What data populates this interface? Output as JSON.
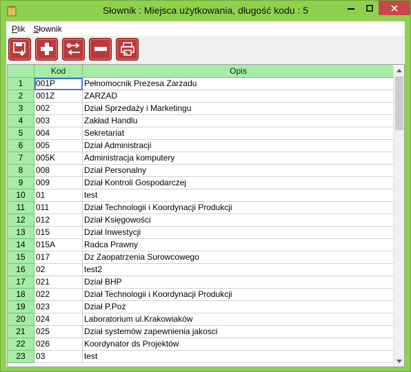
{
  "window": {
    "title": "Słownik : Miejsca użytkowania,  długość kodu : 5"
  },
  "menu": [
    {
      "label": "Plik",
      "accel": "P",
      "rest": "lik"
    },
    {
      "label": "Słownik",
      "accel": "S",
      "rest": "łownik"
    }
  ],
  "toolbar": [
    {
      "name": "save-button",
      "icon": "save-icon"
    },
    {
      "name": "add-button",
      "icon": "plus-icon"
    },
    {
      "name": "swap-button",
      "icon": "key-swap-icon"
    },
    {
      "name": "remove-button",
      "icon": "minus-icon"
    },
    {
      "name": "print-button",
      "icon": "printer-icon"
    }
  ],
  "table": {
    "columns": [
      "Kod",
      "Opis"
    ],
    "rows": [
      {
        "n": "1",
        "kod": "001P",
        "opis": "Pełnomocnik Prezesa Zarzadu"
      },
      {
        "n": "2",
        "kod": "001Z",
        "opis": "ZARZAD"
      },
      {
        "n": "3",
        "kod": "002",
        "opis": "Dział Sprzedaży i Marketingu"
      },
      {
        "n": "4",
        "kod": "003",
        "opis": "Zakład Handlu"
      },
      {
        "n": "5",
        "kod": "004",
        "opis": "Sekretariat"
      },
      {
        "n": "6",
        "kod": "005",
        "opis": "Dział Administracji"
      },
      {
        "n": "7",
        "kod": "005K",
        "opis": "Administracja komputery"
      },
      {
        "n": "8",
        "kod": "008",
        "opis": "Dział Personalny"
      },
      {
        "n": "9",
        "kod": "009",
        "opis": "Dział Kontroli Gospodarczej"
      },
      {
        "n": "10",
        "kod": "01",
        "opis": "test"
      },
      {
        "n": "11",
        "kod": "011",
        "opis": "Dział Technologii i Koordynacji Produkcji"
      },
      {
        "n": "12",
        "kod": "012",
        "opis": "Dział Księgowości"
      },
      {
        "n": "13",
        "kod": "015",
        "opis": "Dział Inwestycji"
      },
      {
        "n": "14",
        "kod": "015A",
        "opis": "Radca Prawny"
      },
      {
        "n": "15",
        "kod": "017",
        "opis": "Dz Zaopatrzenia Surowcowego"
      },
      {
        "n": "16",
        "kod": "02",
        "opis": "test2"
      },
      {
        "n": "17",
        "kod": "021",
        "opis": "Dział BHP"
      },
      {
        "n": "18",
        "kod": "022",
        "opis": "Dział Technologii i Koordynacji Produkcji"
      },
      {
        "n": "19",
        "kod": "023",
        "opis": "Dział P.Poż"
      },
      {
        "n": "20",
        "kod": "024",
        "opis": "Laboratorium  ul.Krakowiaków"
      },
      {
        "n": "21",
        "kod": "025",
        "opis": "Dział systemów  zapewnienia  jakosci"
      },
      {
        "n": "22",
        "kod": "026",
        "opis": "Koordynator ds Projektów"
      },
      {
        "n": "23",
        "kod": "03",
        "opis": "test"
      }
    ]
  },
  "colors": {
    "accent": "#8fd14f",
    "header": "#a6eba6",
    "button": "#b83a3a",
    "close": "#c74848"
  }
}
